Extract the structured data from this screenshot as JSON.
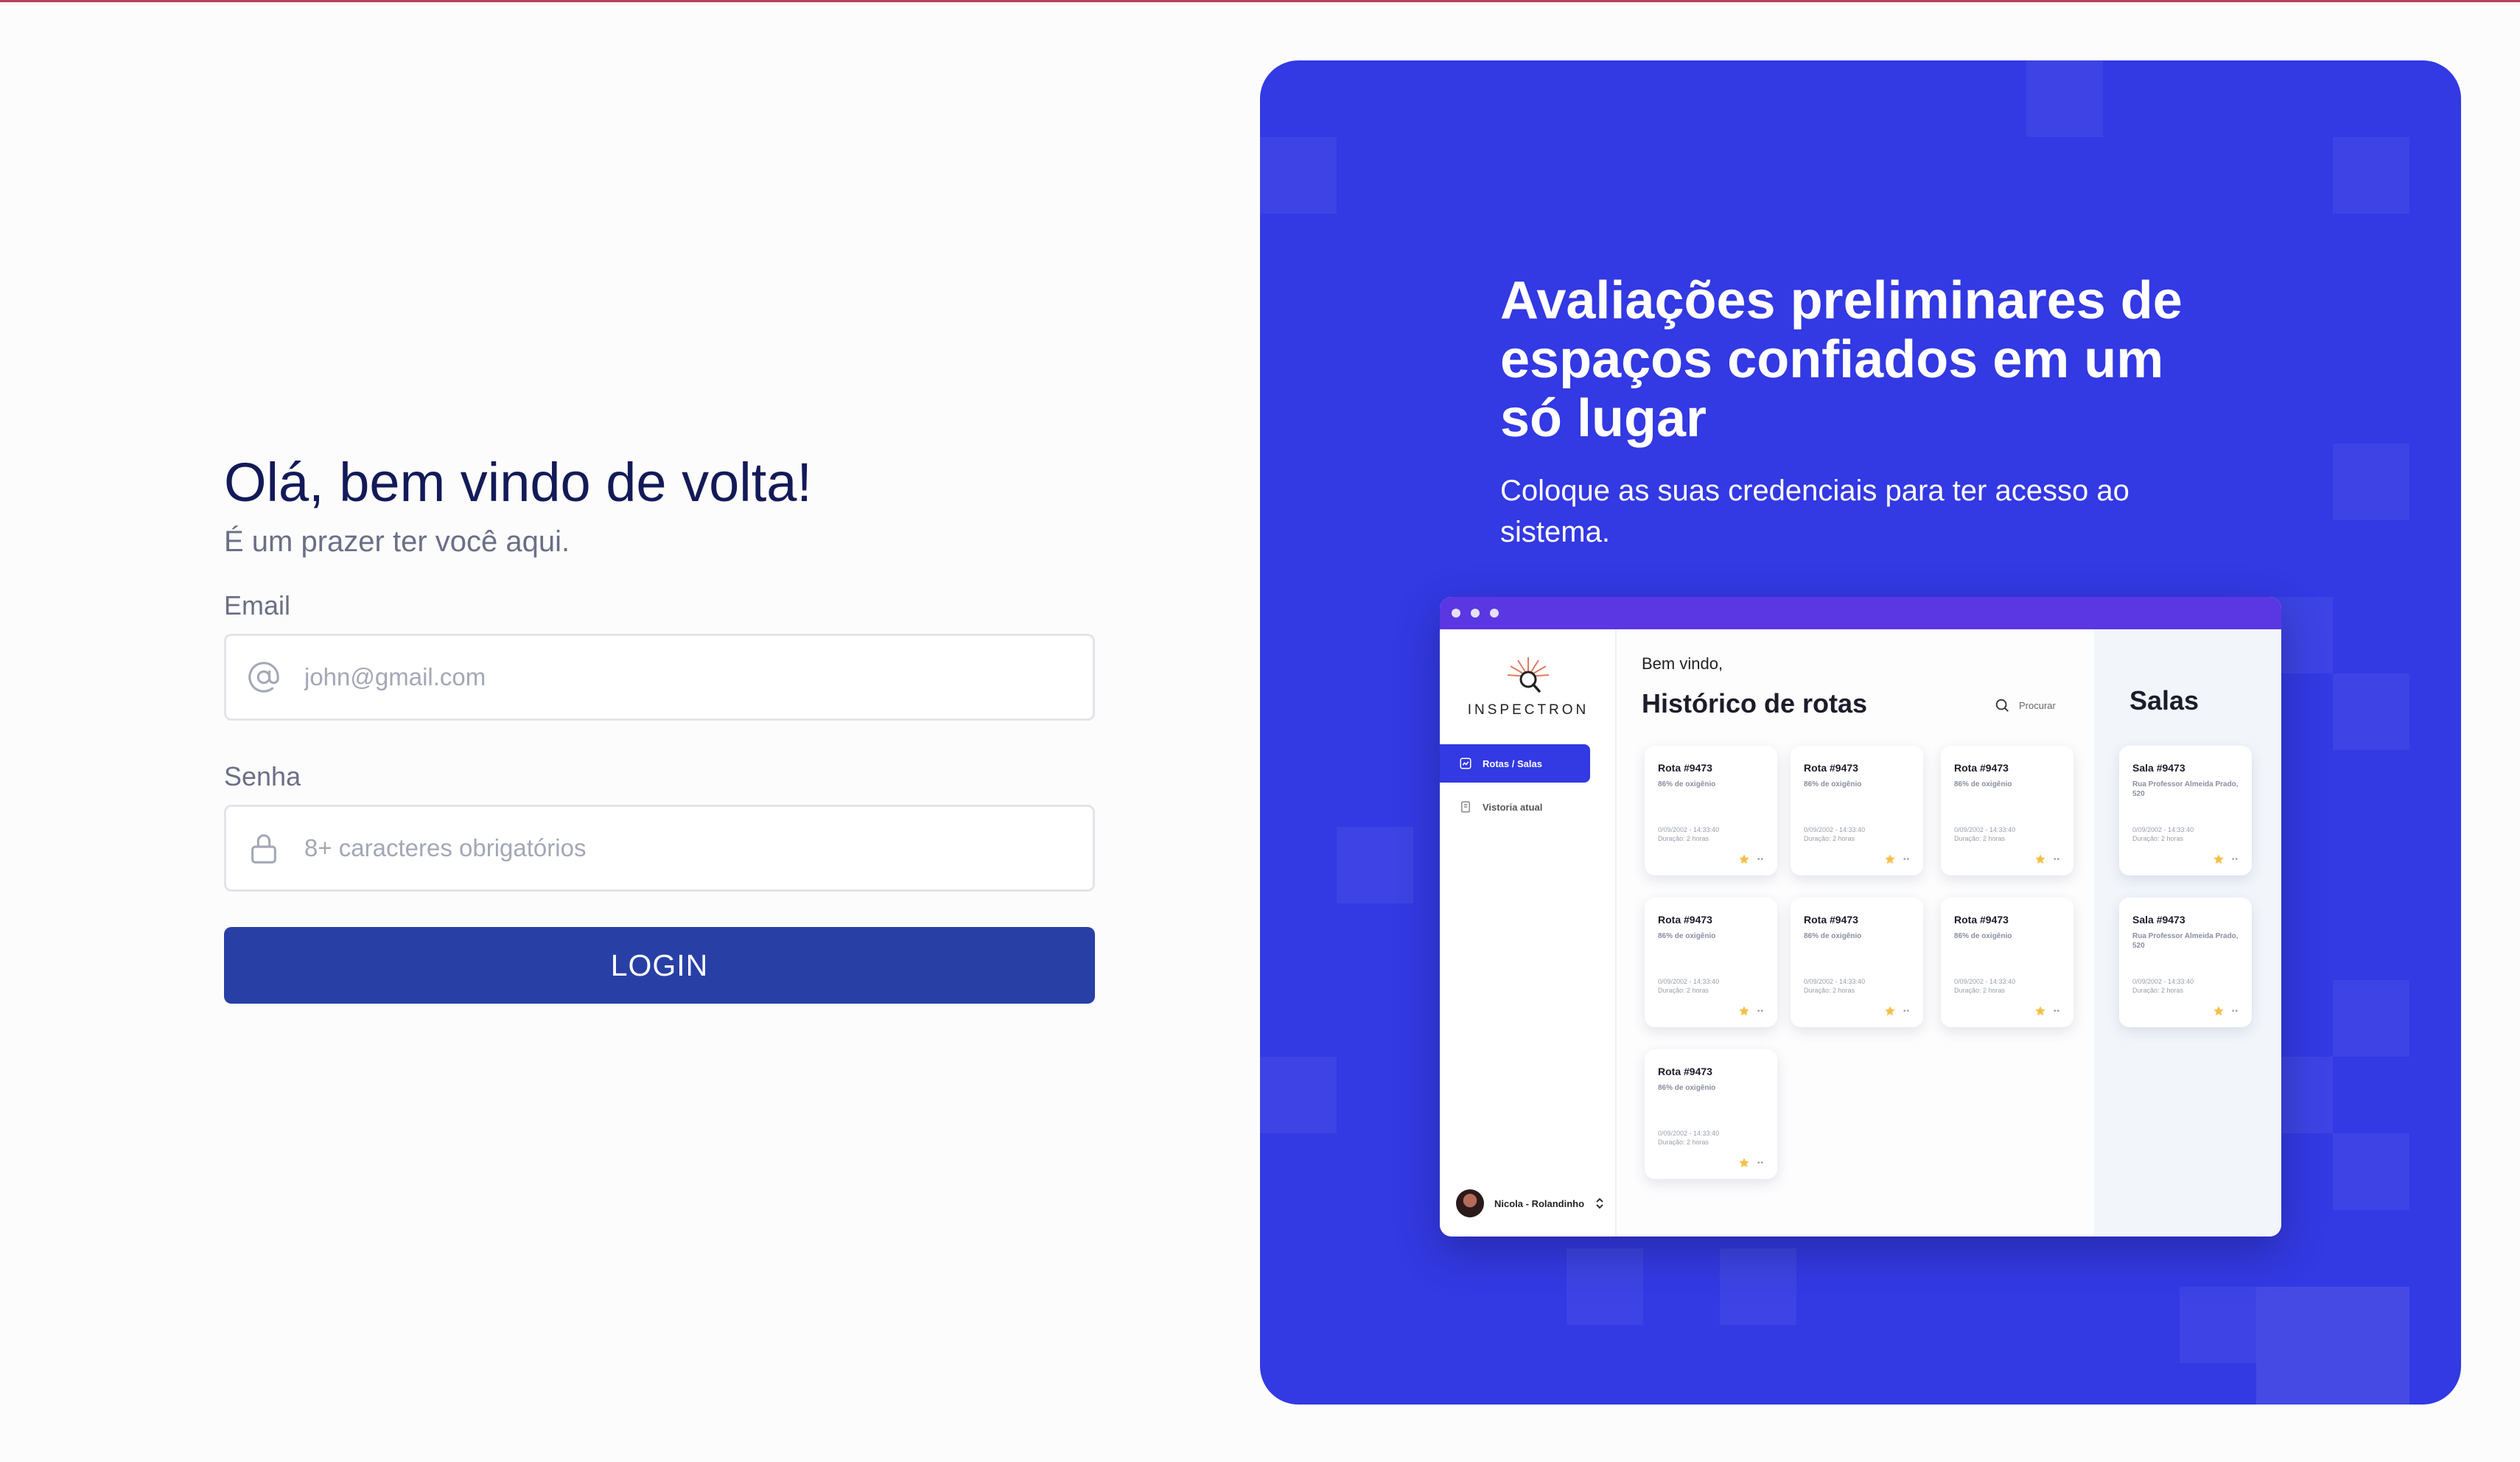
{
  "login": {
    "greeting": "Olá, bem vindo de volta!",
    "subtitle": "É um prazer ter você aqui.",
    "email_label": "Email",
    "email_placeholder": "john@gmail.com",
    "email_icon": "at-icon",
    "password_label": "Senha",
    "password_placeholder": "8+ caracteres obrigatórios",
    "password_icon": "lock-icon",
    "button_label": "LOGIN"
  },
  "hero": {
    "title": "Avaliações preliminares de espaços confiados em um só lugar",
    "subtitle": "Coloque as suas credenciais para ter acesso ao sistema.",
    "background_color": "#3339e3"
  },
  "preview": {
    "logo_text": "INSPECTRON",
    "nav_items": [
      "Rotas / Salas",
      "Vistoria atual"
    ],
    "user_name": "Nicola - Rolandinho",
    "welcome": "Bem vindo,",
    "heading": "Histórico de rotas",
    "search_label": "Procurar",
    "salas_heading": "Salas",
    "route_cards": [
      {
        "title": "Rota #9473",
        "sub": "86% de oxigênio",
        "date": "0/09/2002 - 14:33:40",
        "duration": "Duração: 2 horas"
      },
      {
        "title": "Rota #9473",
        "sub": "86% de oxigênio",
        "date": "0/09/2002 - 14:33:40",
        "duration": "Duração: 2 horas"
      },
      {
        "title": "Rota #9473",
        "sub": "86% de oxigênio",
        "date": "0/09/2002 - 14:33:40",
        "duration": "Duração: 2 horas"
      },
      {
        "title": "Rota #9473",
        "sub": "86% de oxigênio",
        "date": "0/09/2002 - 14:33:40",
        "duration": "Duração: 2 horas"
      },
      {
        "title": "Rota #9473",
        "sub": "86% de oxigênio",
        "date": "0/09/2002 - 14:33:40",
        "duration": "Duração: 2 horas"
      },
      {
        "title": "Rota #9473",
        "sub": "86% de oxigênio",
        "date": "0/09/2002 - 14:33:40",
        "duration": "Duração: 2 horas"
      },
      {
        "title": "Rota #9473",
        "sub": "86% de oxigênio",
        "date": "0/09/2002 - 14:33:40",
        "duration": "Duração: 2 horas"
      }
    ],
    "sala_cards": [
      {
        "title": "Sala #9473",
        "sub": "Rua Professor Almeida Prado, 520",
        "date": "0/09/2002 - 14:33:40",
        "duration": "Duração: 2 horas"
      },
      {
        "title": "Sala #9473",
        "sub": "Rua Professor Almeida Prado, 520",
        "date": "0/09/2002 - 14:33:40",
        "duration": "Duração: 2 horas"
      }
    ],
    "star_color": "#f5c04a"
  }
}
